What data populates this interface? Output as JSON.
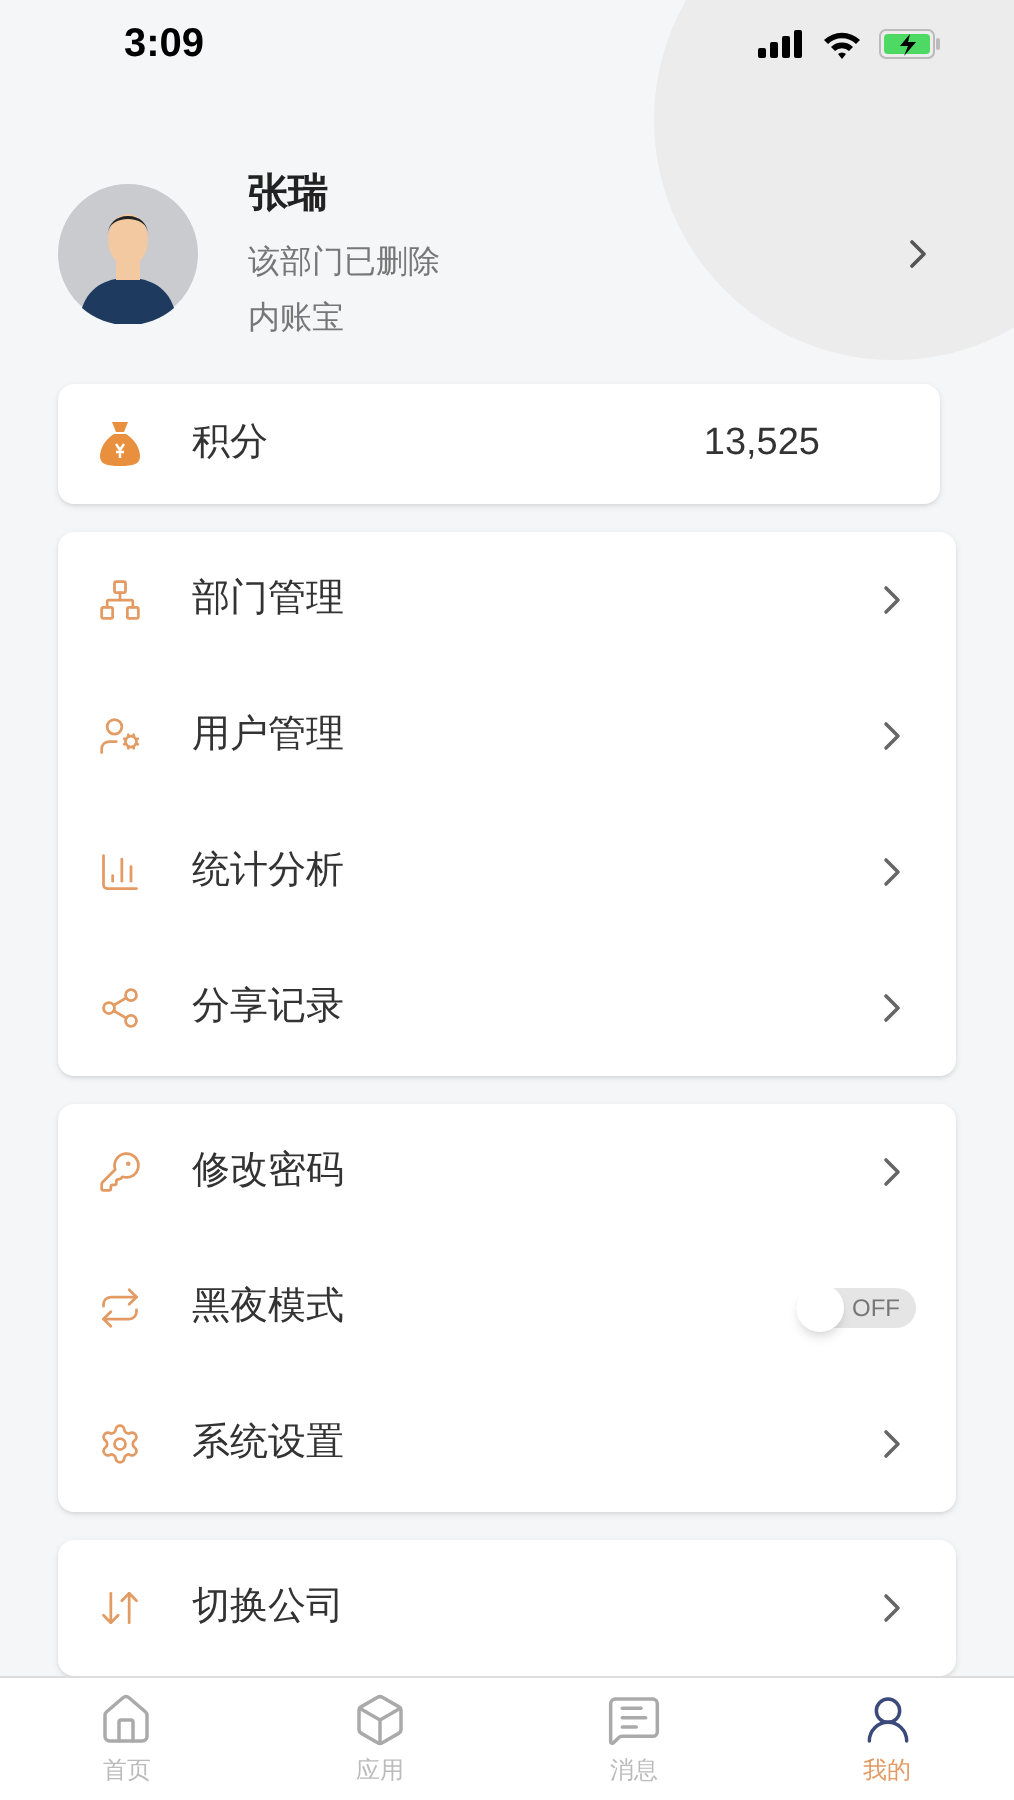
{
  "status_bar": {
    "time": "3:09"
  },
  "profile": {
    "name": "张瑞",
    "department": "该部门已删除",
    "company": "内账宝"
  },
  "points": {
    "label": "积分",
    "value": "13,525"
  },
  "menu_groups": [
    [
      {
        "kind": "link",
        "label": "部门管理"
      },
      {
        "kind": "link",
        "label": "用户管理"
      },
      {
        "kind": "link",
        "label": "统计分析"
      },
      {
        "kind": "link",
        "label": "分享记录"
      }
    ],
    [
      {
        "kind": "link",
        "label": "修改密码"
      },
      {
        "kind": "toggle",
        "label": "黑夜模式",
        "on": false,
        "state_text": "OFF"
      },
      {
        "kind": "link",
        "label": "系统设置"
      }
    ],
    [
      {
        "kind": "link",
        "label": "切换公司"
      }
    ]
  ],
  "tab_bar": [
    {
      "label": "首页",
      "selected": false
    },
    {
      "label": "应用",
      "selected": false
    },
    {
      "label": "消息",
      "selected": false
    },
    {
      "label": "我的",
      "selected": true
    }
  ]
}
